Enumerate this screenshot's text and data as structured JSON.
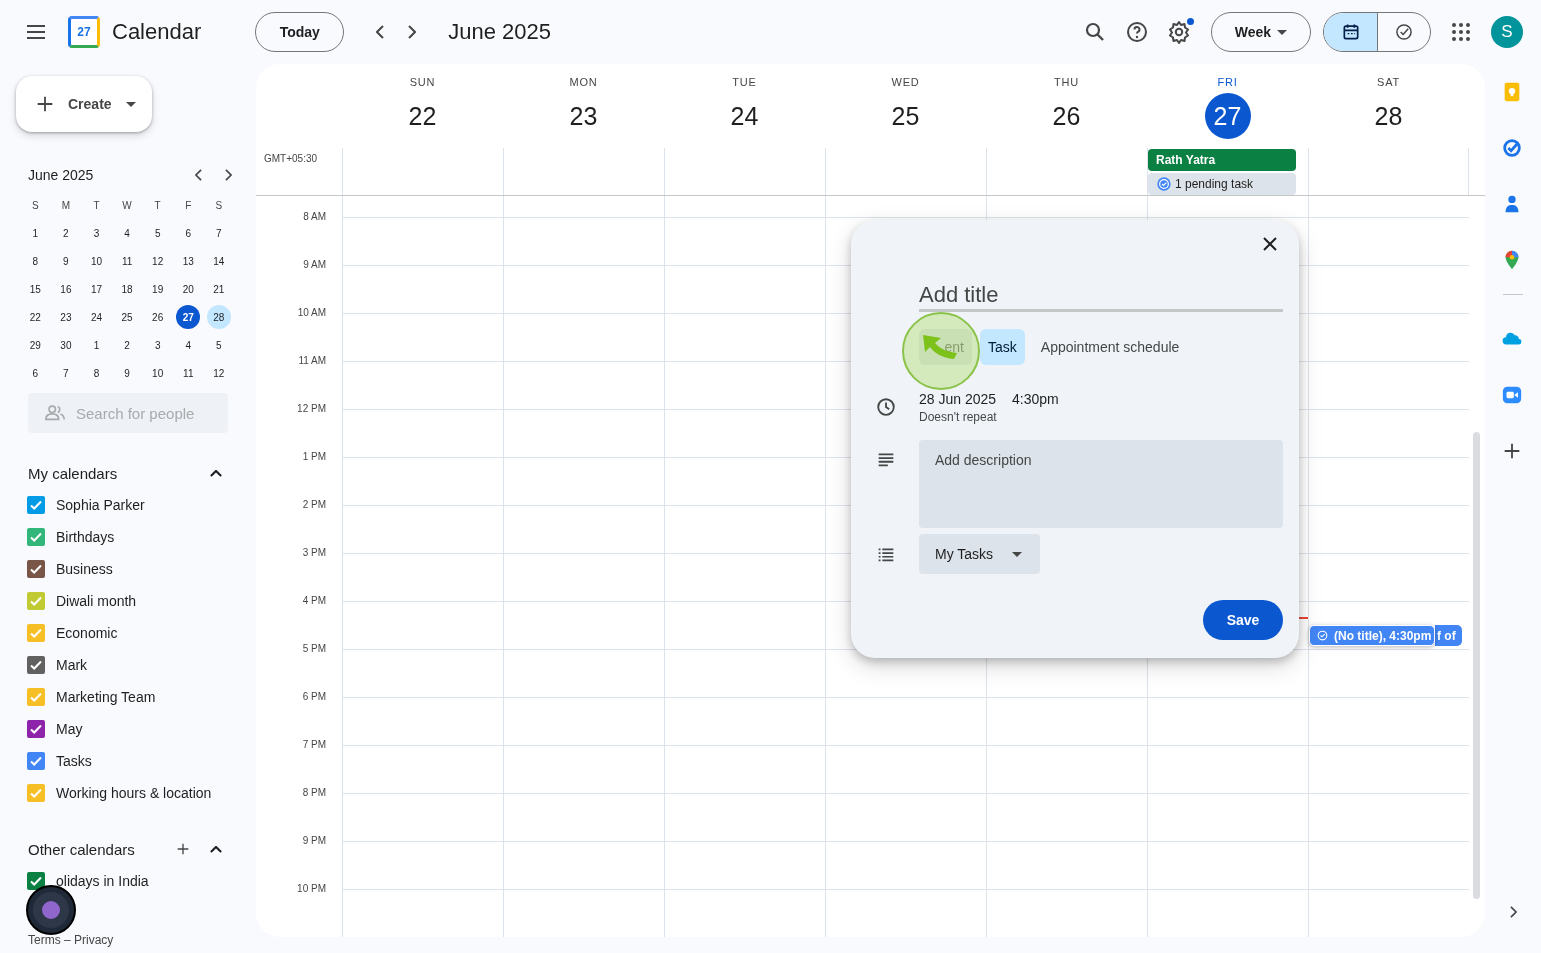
{
  "header": {
    "app_name": "Calendar",
    "logo_text": "27",
    "today_button": "Today",
    "period": "June 2025",
    "settings_badge": true,
    "view_button": "Week",
    "view_toggle": [
      {
        "kind": "calendar",
        "selected": true
      },
      {
        "kind": "tasks",
        "selected": false
      }
    ],
    "avatar": "S"
  },
  "sidebar": {
    "create": "Create",
    "mini_calendar": {
      "title": "June 2025",
      "weekdays": [
        "S",
        "M",
        "T",
        "W",
        "T",
        "F",
        "S"
      ],
      "weeks": [
        [
          {
            "label": "1",
            "today": false,
            "selected": false
          },
          {
            "label": "2",
            "today": false,
            "selected": false
          },
          {
            "label": "3",
            "today": false,
            "selected": false
          },
          {
            "label": "4",
            "today": false,
            "selected": false
          },
          {
            "label": "5",
            "today": false,
            "selected": false
          },
          {
            "label": "6",
            "today": false,
            "selected": false
          },
          {
            "label": "7",
            "today": false,
            "selected": false
          }
        ],
        [
          {
            "label": "8",
            "today": false,
            "selected": false
          },
          {
            "label": "9",
            "today": false,
            "selected": false
          },
          {
            "label": "10",
            "today": false,
            "selected": false
          },
          {
            "label": "11",
            "today": false,
            "selected": false
          },
          {
            "label": "12",
            "today": false,
            "selected": false
          },
          {
            "label": "13",
            "today": false,
            "selected": false
          },
          {
            "label": "14",
            "today": false,
            "selected": false
          }
        ],
        [
          {
            "label": "15",
            "today": false,
            "selected": false
          },
          {
            "label": "16",
            "today": false,
            "selected": false
          },
          {
            "label": "17",
            "today": false,
            "selected": false
          },
          {
            "label": "18",
            "today": false,
            "selected": false
          },
          {
            "label": "19",
            "today": false,
            "selected": false
          },
          {
            "label": "20",
            "today": false,
            "selected": false
          },
          {
            "label": "21",
            "today": false,
            "selected": false
          }
        ],
        [
          {
            "label": "22",
            "today": false,
            "selected": false
          },
          {
            "label": "23",
            "today": false,
            "selected": false
          },
          {
            "label": "24",
            "today": false,
            "selected": false
          },
          {
            "label": "25",
            "today": false,
            "selected": false
          },
          {
            "label": "26",
            "today": false,
            "selected": false
          },
          {
            "label": "27",
            "today": true,
            "selected": false
          },
          {
            "label": "28",
            "today": false,
            "selected": true
          }
        ],
        [
          {
            "label": "29",
            "today": false,
            "selected": false
          },
          {
            "label": "30",
            "today": false,
            "selected": false
          },
          {
            "label": "1",
            "today": false,
            "selected": false
          },
          {
            "label": "2",
            "today": false,
            "selected": false
          },
          {
            "label": "3",
            "today": false,
            "selected": false
          },
          {
            "label": "4",
            "today": false,
            "selected": false
          },
          {
            "label": "5",
            "today": false,
            "selected": false
          }
        ],
        [
          {
            "label": "6",
            "today": false,
            "selected": false
          },
          {
            "label": "7",
            "today": false,
            "selected": false
          },
          {
            "label": "8",
            "today": false,
            "selected": false
          },
          {
            "label": "9",
            "today": false,
            "selected": false
          },
          {
            "label": "10",
            "today": false,
            "selected": false
          },
          {
            "label": "11",
            "today": false,
            "selected": false
          },
          {
            "label": "12",
            "today": false,
            "selected": false
          }
        ]
      ]
    },
    "search_placeholder": "Search for people",
    "my_calendars": {
      "title": "My calendars",
      "expanded": true,
      "items": [
        {
          "label": "Sophia Parker",
          "color": "#039be5",
          "checked": true
        },
        {
          "label": "Birthdays",
          "color": "#33b679",
          "checked": true
        },
        {
          "label": "Business",
          "color": "#795548",
          "checked": true
        },
        {
          "label": "Diwali month",
          "color": "#c0ca33",
          "checked": true
        },
        {
          "label": "Economic",
          "color": "#f6bf26",
          "checked": true
        },
        {
          "label": "Mark",
          "color": "#616161",
          "checked": true
        },
        {
          "label": "Marketing Team",
          "color": "#f6bf26",
          "checked": true
        },
        {
          "label": "May",
          "color": "#8e24aa",
          "checked": true
        },
        {
          "label": "Tasks",
          "color": "#4285f4",
          "checked": true
        },
        {
          "label": "Working hours & location",
          "color": "#f6bf26",
          "checked": true
        }
      ]
    },
    "other_calendars": {
      "title": "Other calendars",
      "expanded": true,
      "items": [
        {
          "label": "olidays in India",
          "color": "#0b8043",
          "checked": true
        }
      ]
    },
    "footer": "Terms – Privacy"
  },
  "week": {
    "timezone": "GMT+05:30",
    "days": [
      {
        "weekday": "SUN",
        "date": "22",
        "today": false
      },
      {
        "weekday": "MON",
        "date": "23",
        "today": false
      },
      {
        "weekday": "TUE",
        "date": "24",
        "today": false
      },
      {
        "weekday": "WED",
        "date": "25",
        "today": false
      },
      {
        "weekday": "THU",
        "date": "26",
        "today": false
      },
      {
        "weekday": "FRI",
        "date": "27",
        "today": true,
        "all_day": [
          {
            "kind": "event",
            "title": "Rath Yatra",
            "color": "#0b8043"
          },
          {
            "kind": "tasks",
            "title": "1 pending task"
          }
        ]
      },
      {
        "weekday": "SAT",
        "date": "28",
        "today": false,
        "events": [
          {
            "kind": "task",
            "title": "(No title), 4:30pm"
          },
          {
            "kind": "partial",
            "title": "f of"
          }
        ]
      }
    ],
    "hours": [
      "8 AM",
      "9 AM",
      "10 AM",
      "11 AM",
      "12 PM",
      "1 PM",
      "2 PM",
      "3 PM",
      "4 PM",
      "5 PM",
      "6 PM",
      "7 PM",
      "8 PM",
      "9 PM",
      "10 PM"
    ]
  },
  "dialog": {
    "title_placeholder": "Add title",
    "tabs": [
      {
        "label": "ent",
        "selected": false
      },
      {
        "label": "Task",
        "selected": true
      },
      {
        "label": "Appointment schedule",
        "selected": false
      }
    ],
    "date": "28 Jun 2025",
    "time": "4:30pm",
    "repeat": "Doesn't repeat",
    "description_placeholder": "Add description",
    "list": "My Tasks",
    "save": "Save"
  }
}
